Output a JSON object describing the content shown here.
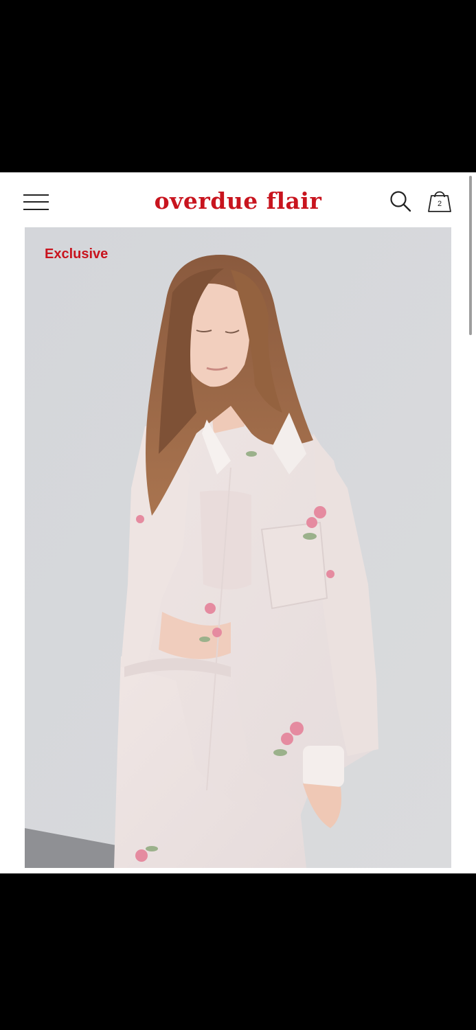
{
  "header": {
    "brand": "overdue flair",
    "menu_icon": "hamburger-menu-icon",
    "search_icon": "search-icon",
    "cart_icon": "shopping-bag-icon",
    "cart_count": "2"
  },
  "product": {
    "badge": "Exclusive",
    "image_alt_icon": "model-photo"
  },
  "colors": {
    "brand": "#c8141e",
    "badge": "#c8141e",
    "background": "#ffffff",
    "photo_backdrop": "#d7d8dc"
  }
}
